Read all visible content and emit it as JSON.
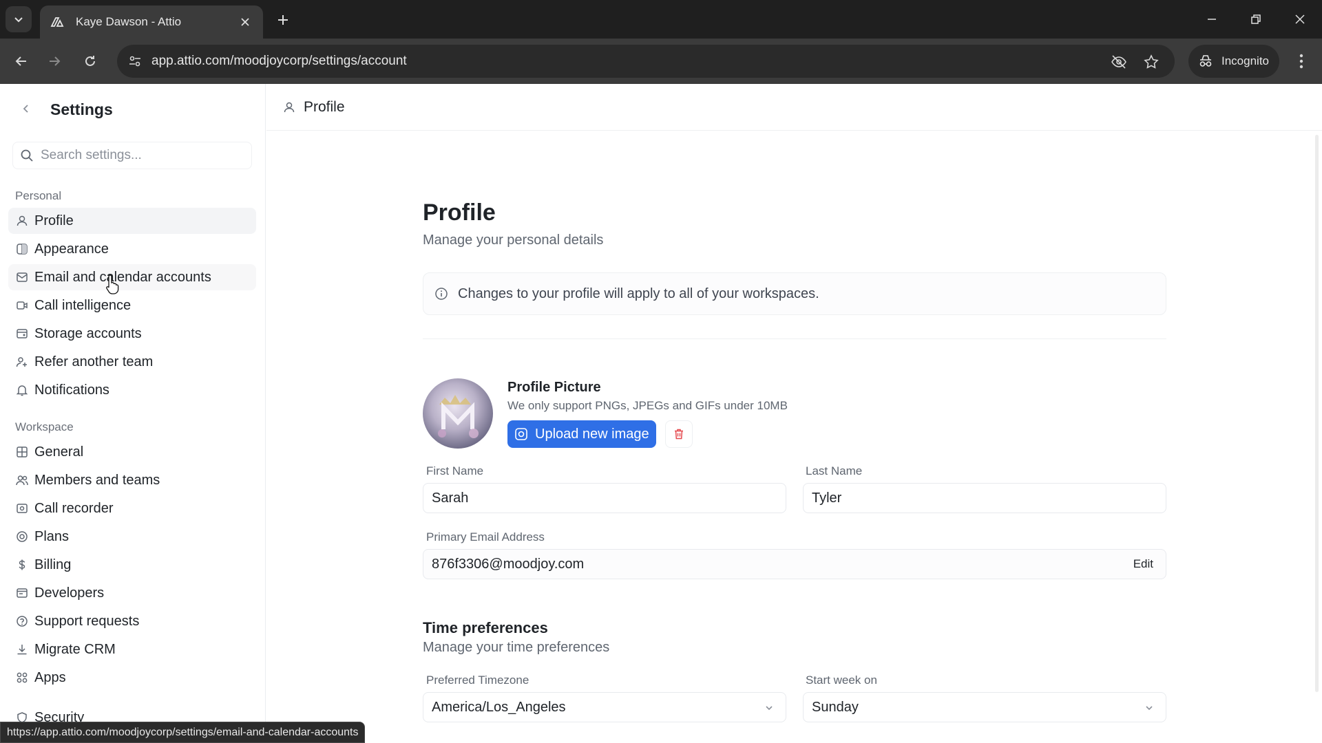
{
  "browser": {
    "tab_title": "Kaye Dawson - Attio",
    "url": "app.attio.com/moodjoycorp/settings/account",
    "incognito_label": "Incognito",
    "status_url": "https://app.attio.com/moodjoycorp/settings/email-and-calendar-accounts"
  },
  "sidebar": {
    "title": "Settings",
    "search_placeholder": "Search settings...",
    "personal_label": "Personal",
    "workspace_label": "Workspace",
    "personal_items": [
      {
        "label": "Profile",
        "icon": "user-icon"
      },
      {
        "label": "Appearance",
        "icon": "appearance-icon"
      },
      {
        "label": "Email and calendar accounts",
        "icon": "mail-calendar-icon"
      },
      {
        "label": "Call intelligence",
        "icon": "call-intelligence-icon"
      },
      {
        "label": "Storage accounts",
        "icon": "storage-icon"
      },
      {
        "label": "Refer another team",
        "icon": "refer-icon"
      },
      {
        "label": "Notifications",
        "icon": "bell-icon"
      }
    ],
    "workspace_items": [
      {
        "label": "General",
        "icon": "grid-icon"
      },
      {
        "label": "Members and teams",
        "icon": "users-icon"
      },
      {
        "label": "Call recorder",
        "icon": "recorder-icon"
      },
      {
        "label": "Plans",
        "icon": "plans-icon"
      },
      {
        "label": "Billing",
        "icon": "dollar-icon"
      },
      {
        "label": "Developers",
        "icon": "code-icon"
      },
      {
        "label": "Support requests",
        "icon": "help-icon"
      },
      {
        "label": "Migrate CRM",
        "icon": "download-icon"
      },
      {
        "label": "Apps",
        "icon": "apps-icon"
      }
    ],
    "cut_item": "Security"
  },
  "header": {
    "title": "Profile"
  },
  "profile": {
    "title": "Profile",
    "subtitle": "Manage your personal details",
    "notice": "Changes to your profile will apply to all of your workspaces.",
    "picture_title": "Profile Picture",
    "picture_sub": "We only support PNGs, JPEGs and GIFs under 10MB",
    "upload_label": "Upload new image",
    "first_name_label": "First Name",
    "first_name": "Sarah",
    "last_name_label": "Last Name",
    "last_name": "Tyler",
    "email_label": "Primary Email Address",
    "email": "876f3306@moodjoy.com",
    "edit_label": "Edit"
  },
  "time_prefs": {
    "title": "Time preferences",
    "subtitle": "Manage your time preferences",
    "timezone_label": "Preferred Timezone",
    "timezone": "America/Los_Angeles",
    "week_label": "Start week on",
    "week": "Sunday"
  },
  "colors": {
    "accent": "#2f6fe6",
    "danger": "#e5484d"
  }
}
